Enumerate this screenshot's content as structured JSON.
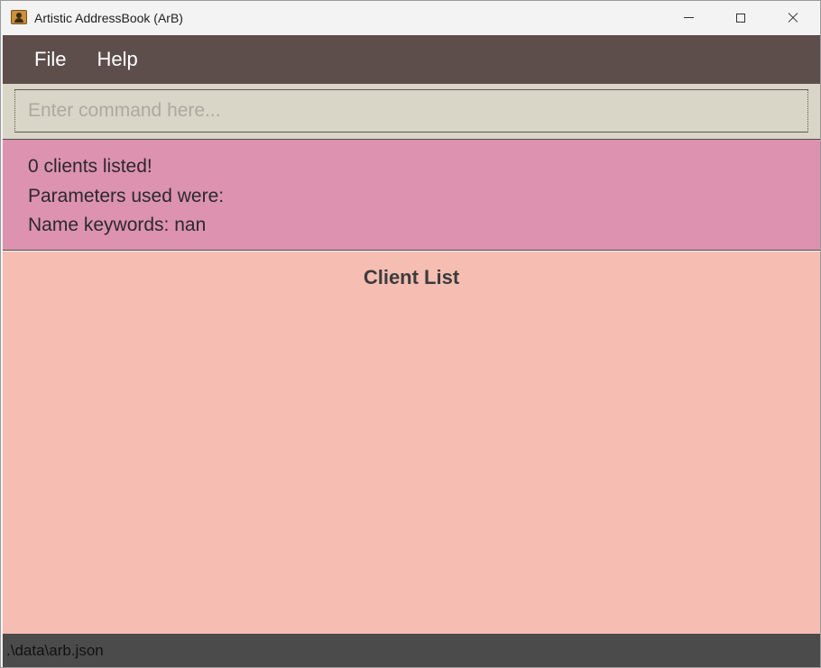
{
  "window": {
    "title": "Artistic AddressBook (ArB)",
    "icon": "addressbook-app-icon"
  },
  "menu": {
    "items": [
      {
        "label": "File"
      },
      {
        "label": "Help"
      }
    ]
  },
  "command": {
    "placeholder": "Enter command here...",
    "value": ""
  },
  "result": {
    "lines": [
      "0 clients listed!",
      "Parameters used were:",
      "Name keywords: nan"
    ]
  },
  "client_list": {
    "title": "Client List",
    "items": []
  },
  "status": {
    "file_path": ".\\data\\arb.json"
  },
  "colors": {
    "menubar": "#5d4e4b",
    "command_bg": "#d9d6c8",
    "result_bg": "#dd92b0",
    "list_bg": "#f6bdb2",
    "statusbar": "#4b4b4b"
  }
}
